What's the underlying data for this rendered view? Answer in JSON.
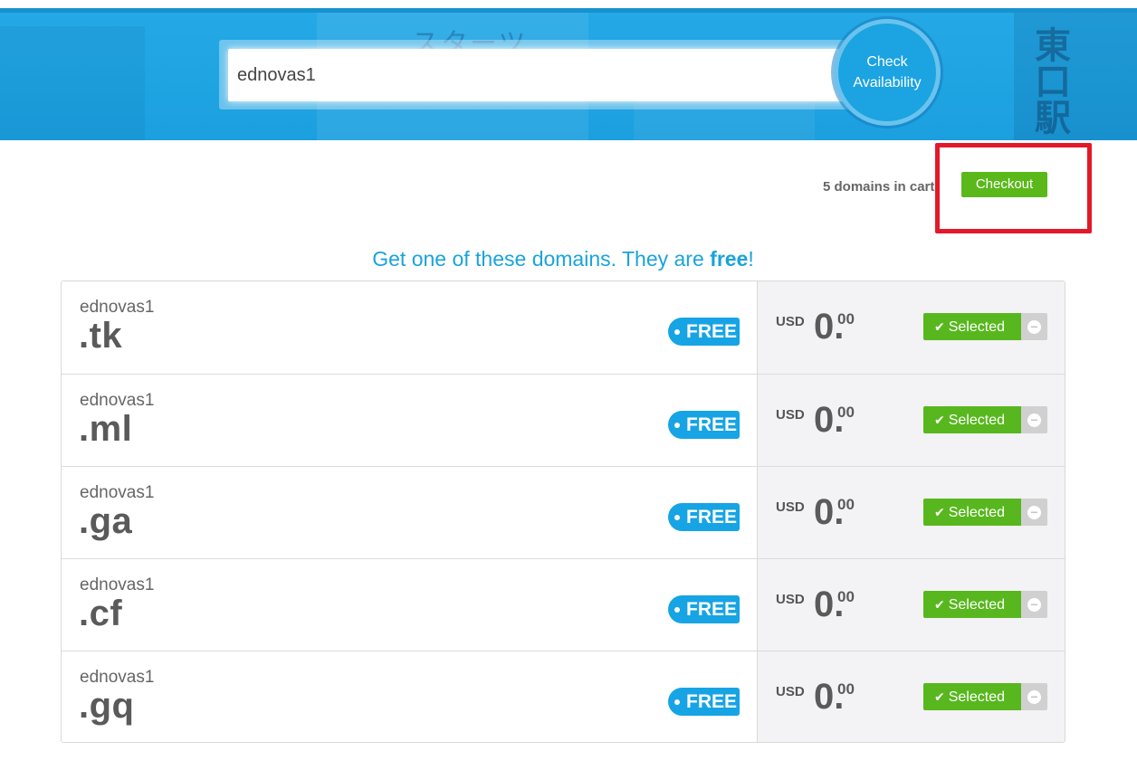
{
  "search": {
    "value": "ednovas1"
  },
  "check_button": {
    "line1": "Check",
    "line2": "Availability"
  },
  "cart": {
    "summary": "5 domains in cart",
    "checkout_label": "Checkout"
  },
  "headline": {
    "prefix": "Get one of these domains. They are ",
    "emphasis": "free",
    "suffix": "!"
  },
  "domains": [
    {
      "name": "ednovas1",
      "tld": ".tk",
      "badge": "FREE",
      "currency": "USD",
      "price_int": "0.",
      "price_cents": "00",
      "status": "Selected"
    },
    {
      "name": "ednovas1",
      "tld": ".ml",
      "badge": "FREE",
      "currency": "USD",
      "price_int": "0.",
      "price_cents": "00",
      "status": "Selected"
    },
    {
      "name": "ednovas1",
      "tld": ".ga",
      "badge": "FREE",
      "currency": "USD",
      "price_int": "0.",
      "price_cents": "00",
      "status": "Selected"
    },
    {
      "name": "ednovas1",
      "tld": ".cf",
      "badge": "FREE",
      "currency": "USD",
      "price_int": "0.",
      "price_cents": "00",
      "status": "Selected"
    },
    {
      "name": "ednovas1",
      "tld": ".gq",
      "badge": "FREE",
      "currency": "USD",
      "price_int": "0.",
      "price_cents": "00",
      "status": "Selected"
    }
  ],
  "colors": {
    "accent": "#1aa3dc",
    "select_green": "#58b71e",
    "highlight_red": "#e3192a"
  }
}
